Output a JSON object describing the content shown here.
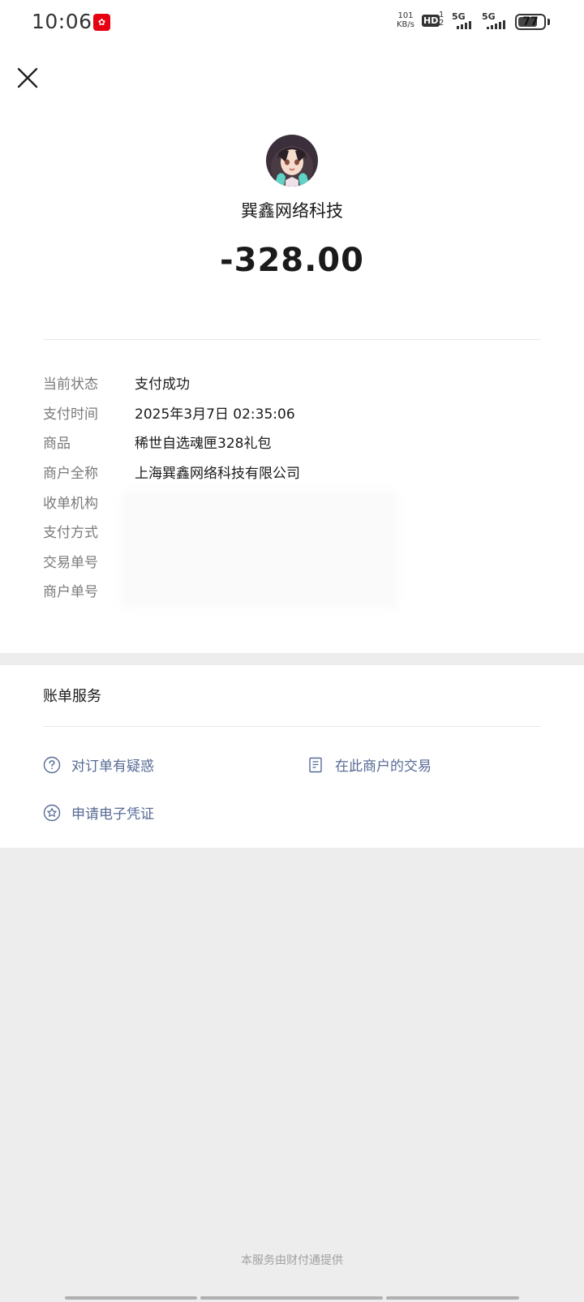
{
  "status_bar": {
    "time": "10:06",
    "net_speed_value": "101",
    "net_speed_unit": "KB/s",
    "hd_label": "HD",
    "hd_sub_top": "1",
    "hd_sub_bottom": "2",
    "sim1_label": "5G",
    "sim2_label": "5G",
    "battery_level": "77"
  },
  "header": {
    "close_icon": "close-icon"
  },
  "payment": {
    "merchant_name": "巽鑫网络科技",
    "amount": "-328.00"
  },
  "details": [
    {
      "key": "当前状态",
      "value": "支付成功"
    },
    {
      "key": "支付时间",
      "value": "2025年3月7日 02:35:06"
    },
    {
      "key": "商品",
      "value": "稀世自选魂匣328礼包"
    },
    {
      "key": "商户全称",
      "value": "上海巽鑫网络科技有限公司"
    },
    {
      "key": "收单机构",
      "value": ""
    },
    {
      "key": "支付方式",
      "value": ""
    },
    {
      "key": "交易单号",
      "value": ""
    },
    {
      "key": "商户单号",
      "value": ""
    }
  ],
  "services": {
    "title": "账单服务",
    "links": [
      {
        "label": "对订单有疑惑",
        "icon": "question-circle-icon"
      },
      {
        "label": "在此商户的交易",
        "icon": "document-icon"
      },
      {
        "label": "申请电子凭证",
        "icon": "star-circle-icon"
      }
    ]
  },
  "footer": {
    "text": "本服务由财付通提供"
  },
  "colors": {
    "link": "#576b95",
    "label": "#7a7a7a",
    "page_bg": "#ededed"
  }
}
